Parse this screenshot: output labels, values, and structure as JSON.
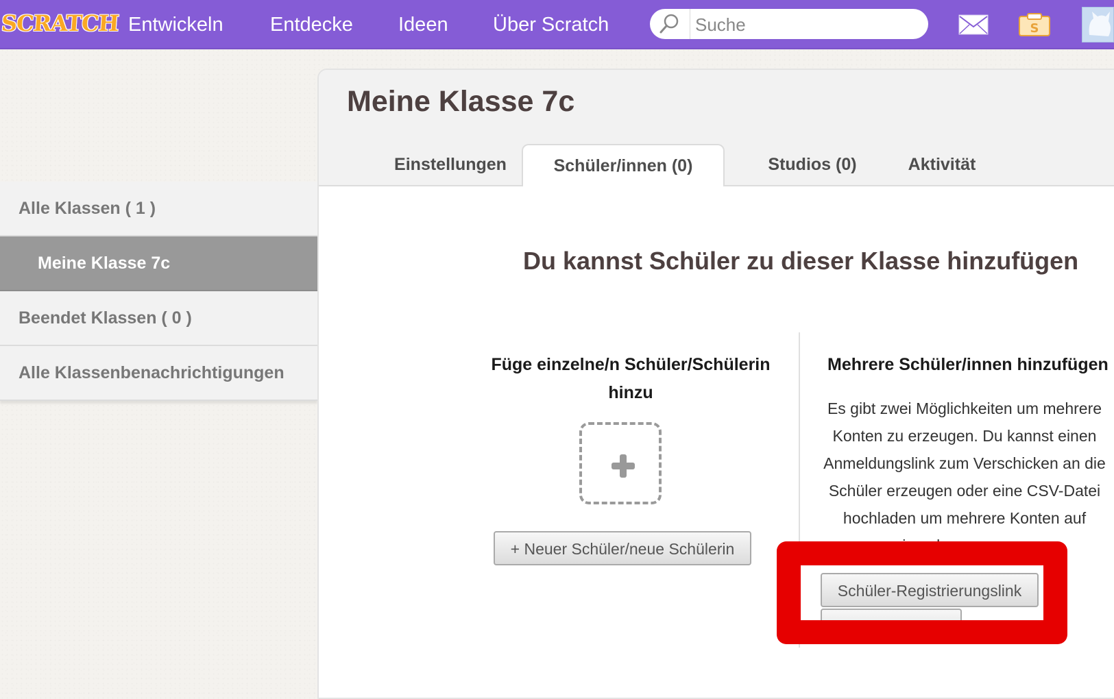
{
  "nav": {
    "logo_text": "SCRATCH",
    "links": [
      "Entwickeln",
      "Entdecke",
      "Ideen",
      "Über Scratch"
    ],
    "search_placeholder": "Suche",
    "icons": [
      "messages-icon",
      "my-stuff-icon",
      "avatar"
    ]
  },
  "sidebar": {
    "items": [
      {
        "label": "Alle Klassen ( 1 )"
      },
      {
        "label": "Meine Klasse 7c"
      },
      {
        "label": "Beendet Klassen ( 0 )"
      },
      {
        "label": "Alle Klassenbenachrichtigungen"
      }
    ]
  },
  "main": {
    "title": "Meine Klasse 7c",
    "tabs": [
      "Einstellungen",
      "Schüler/innen (0)",
      "Studios (0)",
      "Aktivität"
    ],
    "active_tab": "Schüler/innen (0)",
    "add_heading": "Du kannst Schüler zu dieser Klasse hinzufügen",
    "single": {
      "title_line1": "Füge einzelne/n Schüler/Schülerin",
      "title_line2": "hinzu",
      "button": "+ Neuer Schüler/neue Schülerin"
    },
    "multi": {
      "title": "Mehrere Schüler/innen hinzufügen",
      "text_lines": [
        "Es gibt zwei Möglichkeiten um mehrere",
        "Konten zu erzeugen. Du kannst einen",
        "Anmeldungslink zum Verschicken an die",
        "Schüler erzeugen oder eine CSV-Datei",
        "hochladen um mehrere Konten auf",
        "einmal zu erzeugen."
      ],
      "button": "Schüler-Registrierungslink"
    }
  },
  "colors": {
    "nav_bg": "#855cd6",
    "highlight": "#e60000",
    "sidebar_active": "#999999"
  }
}
